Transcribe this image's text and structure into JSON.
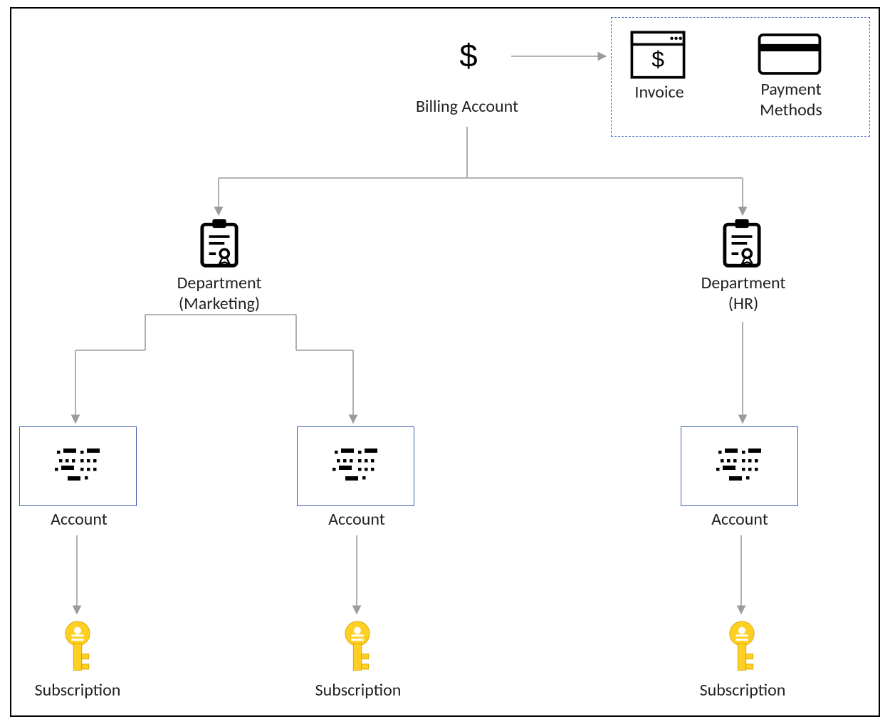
{
  "root": {
    "label": "Billing Account"
  },
  "infoBox": {
    "invoice_label": "Invoice",
    "payment_label": "Payment\nMethods"
  },
  "departments": [
    {
      "label": "Department\n(Marketing)"
    },
    {
      "label": "Department\n(HR)"
    }
  ],
  "accounts": [
    {
      "label": "Account"
    },
    {
      "label": "Account"
    },
    {
      "label": "Account"
    }
  ],
  "subscriptions": [
    {
      "label": "Subscription"
    },
    {
      "label": "Subscription"
    },
    {
      "label": "Subscription"
    }
  ]
}
